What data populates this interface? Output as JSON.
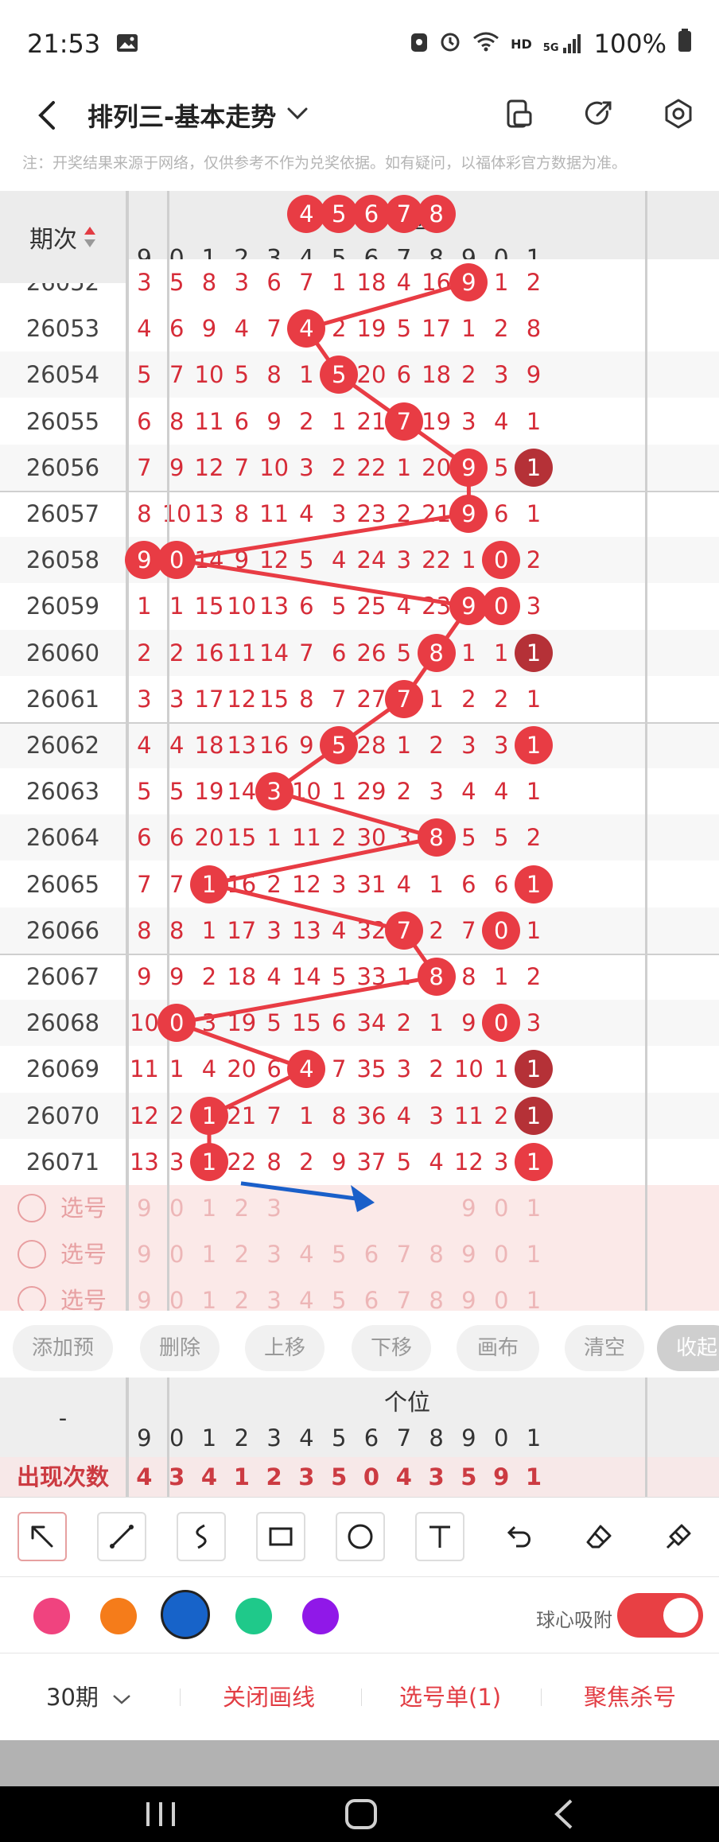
{
  "status_bar": {
    "time": "21:53",
    "battery": "100%",
    "hd": "HD",
    "net": "5G"
  },
  "app": {
    "title": "排列三-基本走势",
    "notice": "注：开奖结果来源于网络，仅供参考不作为兑奖依据。如有疑问，以福体彩官方数据为准。"
  },
  "table": {
    "issue_header": "期次",
    "group_header": "个位",
    "columns": [
      "9",
      "0",
      "1",
      "2",
      "3",
      "4",
      "5",
      "6",
      "7",
      "8",
      "9",
      "0",
      "1"
    ],
    "rows": [
      {
        "issue": "26052",
        "cells": [
          "3",
          "5",
          "8",
          "3",
          "6",
          "7",
          "1",
          "18",
          "4",
          "16",
          "9",
          "1",
          "2"
        ]
      },
      {
        "issue": "26053",
        "cells": [
          "4",
          "6",
          "9",
          "4",
          "7",
          "4",
          "2",
          "19",
          "5",
          "17",
          "1",
          "2",
          "8"
        ]
      },
      {
        "issue": "26054",
        "cells": [
          "5",
          "7",
          "10",
          "5",
          "8",
          "1",
          "5",
          "20",
          "6",
          "18",
          "2",
          "3",
          "9"
        ]
      },
      {
        "issue": "26055",
        "cells": [
          "6",
          "8",
          "11",
          "6",
          "9",
          "2",
          "1",
          "21",
          "7",
          "19",
          "3",
          "4",
          "1"
        ]
      },
      {
        "issue": "26056",
        "cells": [
          "7",
          "9",
          "12",
          "7",
          "10",
          "3",
          "2",
          "22",
          "1",
          "20",
          "9",
          "5",
          "1"
        ]
      },
      {
        "issue": "26057",
        "cells": [
          "8",
          "10",
          "13",
          "8",
          "11",
          "4",
          "3",
          "23",
          "2",
          "21",
          "9",
          "6",
          "1"
        ]
      },
      {
        "issue": "26058",
        "cells": [
          "9",
          "0",
          "14",
          "9",
          "12",
          "5",
          "4",
          "24",
          "3",
          "22",
          "1",
          "0",
          "2"
        ]
      },
      {
        "issue": "26059",
        "cells": [
          "1",
          "1",
          "15",
          "10",
          "13",
          "6",
          "5",
          "25",
          "4",
          "23",
          "9",
          "0",
          "3"
        ]
      },
      {
        "issue": "26060",
        "cells": [
          "2",
          "2",
          "16",
          "11",
          "14",
          "7",
          "6",
          "26",
          "5",
          "8",
          "1",
          "1",
          "1"
        ]
      },
      {
        "issue": "26061",
        "cells": [
          "3",
          "3",
          "17",
          "12",
          "15",
          "8",
          "7",
          "27",
          "7",
          "1",
          "2",
          "2",
          "1"
        ]
      },
      {
        "issue": "26062",
        "cells": [
          "4",
          "4",
          "18",
          "13",
          "16",
          "9",
          "5",
          "28",
          "1",
          "2",
          "3",
          "3",
          "1"
        ]
      },
      {
        "issue": "26063",
        "cells": [
          "5",
          "5",
          "19",
          "14",
          "3",
          "10",
          "1",
          "29",
          "2",
          "3",
          "4",
          "4",
          "1"
        ]
      },
      {
        "issue": "26064",
        "cells": [
          "6",
          "6",
          "20",
          "15",
          "1",
          "11",
          "2",
          "30",
          "3",
          "8",
          "5",
          "5",
          "2"
        ]
      },
      {
        "issue": "26065",
        "cells": [
          "7",
          "7",
          "1",
          "16",
          "2",
          "12",
          "3",
          "31",
          "4",
          "1",
          "6",
          "6",
          "1"
        ]
      },
      {
        "issue": "26066",
        "cells": [
          "8",
          "8",
          "1",
          "17",
          "3",
          "13",
          "4",
          "32",
          "7",
          "2",
          "7",
          "0",
          "1"
        ]
      },
      {
        "issue": "26067",
        "cells": [
          "9",
          "9",
          "2",
          "18",
          "4",
          "14",
          "5",
          "33",
          "1",
          "8",
          "8",
          "1",
          "2"
        ]
      },
      {
        "issue": "26068",
        "cells": [
          "10",
          "0",
          "3",
          "19",
          "5",
          "15",
          "6",
          "34",
          "2",
          "1",
          "9",
          "0",
          "3"
        ]
      },
      {
        "issue": "26069",
        "cells": [
          "11",
          "1",
          "4",
          "20",
          "6",
          "4",
          "7",
          "35",
          "3",
          "2",
          "10",
          "1",
          "1"
        ]
      },
      {
        "issue": "26070",
        "cells": [
          "12",
          "2",
          "1",
          "21",
          "7",
          "1",
          "8",
          "36",
          "4",
          "3",
          "11",
          "2",
          "1"
        ]
      },
      {
        "issue": "26071",
        "cells": [
          "13",
          "3",
          "1",
          "22",
          "8",
          "2",
          "9",
          "37",
          "5",
          "4",
          "12",
          "3",
          "1"
        ]
      }
    ],
    "balls": [
      {
        "row": 0,
        "col": 10
      },
      {
        "row": 1,
        "col": 5
      },
      {
        "row": 2,
        "col": 6
      },
      {
        "row": 3,
        "col": 8
      },
      {
        "row": 4,
        "col": 10
      },
      {
        "row": 4,
        "col": 12,
        "dark": true
      },
      {
        "row": 5,
        "col": 10
      },
      {
        "row": 6,
        "col": 0
      },
      {
        "row": 6,
        "col": 1
      },
      {
        "row": 6,
        "col": 11
      },
      {
        "row": 7,
        "col": 10
      },
      {
        "row": 7,
        "col": 11
      },
      {
        "row": 8,
        "col": 9
      },
      {
        "row": 8,
        "col": 12,
        "dark": true
      },
      {
        "row": 9,
        "col": 8
      },
      {
        "row": 10,
        "col": 6
      },
      {
        "row": 10,
        "col": 12
      },
      {
        "row": 11,
        "col": 4
      },
      {
        "row": 12,
        "col": 9
      },
      {
        "row": 13,
        "col": 2
      },
      {
        "row": 13,
        "col": 12
      },
      {
        "row": 14,
        "col": 8
      },
      {
        "row": 14,
        "col": 11
      },
      {
        "row": 15,
        "col": 9
      },
      {
        "row": 16,
        "col": 1
      },
      {
        "row": 16,
        "col": 11
      },
      {
        "row": 17,
        "col": 5
      },
      {
        "row": 17,
        "col": 12,
        "dark": true
      },
      {
        "row": 18,
        "col": 2
      },
      {
        "row": 18,
        "col": 12,
        "dark": true
      },
      {
        "row": 19,
        "col": 2
      },
      {
        "row": 19,
        "col": 12
      }
    ],
    "trend_path": [
      [
        0,
        10
      ],
      [
        1,
        5
      ],
      [
        2,
        6
      ],
      [
        3,
        8
      ],
      [
        4,
        10
      ],
      [
        5,
        10
      ],
      [
        6,
        1
      ],
      [
        7,
        10
      ],
      [
        8,
        9
      ],
      [
        9,
        8
      ],
      [
        10,
        6
      ],
      [
        11,
        4
      ],
      [
        12,
        9
      ],
      [
        13,
        2
      ],
      [
        14,
        8
      ],
      [
        15,
        9
      ],
      [
        16,
        1
      ],
      [
        17,
        5
      ],
      [
        18,
        2
      ],
      [
        19,
        2
      ]
    ],
    "pick_label": "选号",
    "pick_rows": [
      {
        "cells": [
          "9",
          "0",
          "1",
          "2",
          "3",
          "4",
          "5",
          "6",
          "7",
          "8",
          "9",
          "0",
          "1"
        ],
        "balls": [
          5,
          6,
          7,
          8,
          9
        ]
      },
      {
        "cells": [
          "9",
          "0",
          "1",
          "2",
          "3",
          "4",
          "5",
          "6",
          "7",
          "8",
          "9",
          "0",
          "1"
        ],
        "balls": []
      },
      {
        "cells": [
          "9",
          "0",
          "1",
          "2",
          "3",
          "4",
          "5",
          "6",
          "7",
          "8",
          "9",
          "0",
          "1"
        ],
        "balls": []
      }
    ]
  },
  "buttons": [
    "添加预选",
    "删除",
    "上移",
    "下移",
    "画布+",
    "清空",
    "收起"
  ],
  "stats": {
    "left_header": "-",
    "group_header": "个位",
    "columns": [
      "9",
      "0",
      "1",
      "2",
      "3",
      "4",
      "5",
      "6",
      "7",
      "8",
      "9",
      "0",
      "1"
    ],
    "row_label": "出现次数",
    "values": [
      "4",
      "3",
      "4",
      "1",
      "2",
      "3",
      "5",
      "0",
      "4",
      "3",
      "5",
      "9",
      "1"
    ]
  },
  "tools": [
    "arrow-tool",
    "line-tool",
    "curve-tool",
    "rect-tool",
    "circle-tool",
    "text-tool",
    "undo-tool",
    "eraser-tool",
    "clear-tool"
  ],
  "colors": [
    "#f0437f",
    "#f57c1a",
    "#1763c9",
    "#1fc98a",
    "#9018e8"
  ],
  "magnet_label": "球心吸附",
  "bottom": {
    "period": "30期",
    "close_draw": "关闭画线",
    "pick_list": "选号单(1)",
    "focus_kill": "聚焦杀号"
  },
  "accent": "#e83c44",
  "arrow_color": "#1a5fc9"
}
